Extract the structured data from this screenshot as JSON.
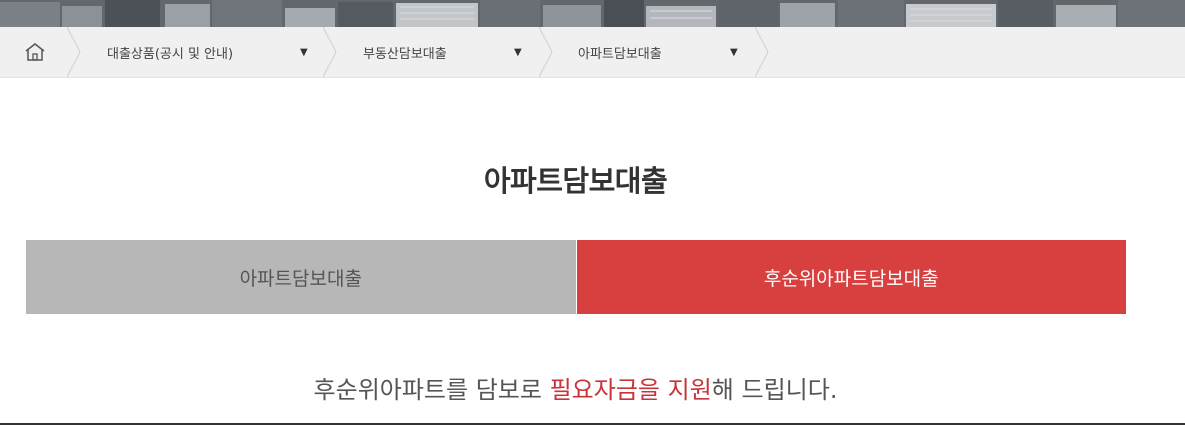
{
  "breadcrumb": {
    "home_icon": "home-icon",
    "items": [
      {
        "label": "대출상품(공시 및 안내)",
        "caret": "▼"
      },
      {
        "label": "부동산담보대출",
        "caret": "▼"
      },
      {
        "label": "아파트담보대출",
        "caret": "▼"
      }
    ]
  },
  "page": {
    "title": "아파트담보대출"
  },
  "tabs": [
    {
      "label": "아파트담보대출",
      "active": false
    },
    {
      "label": "후순위아파트담보대출",
      "active": true
    }
  ],
  "description": {
    "part1": "후순위아파트를 담보로 ",
    "highlight": "필요자금을 지원",
    "part2": "해 드립니다."
  },
  "colors": {
    "accent": "#d84040",
    "inactive_tab": "#b7b7b7",
    "breadcrumb_bg": "#f0f0f0",
    "highlight_text": "#c9333a"
  }
}
